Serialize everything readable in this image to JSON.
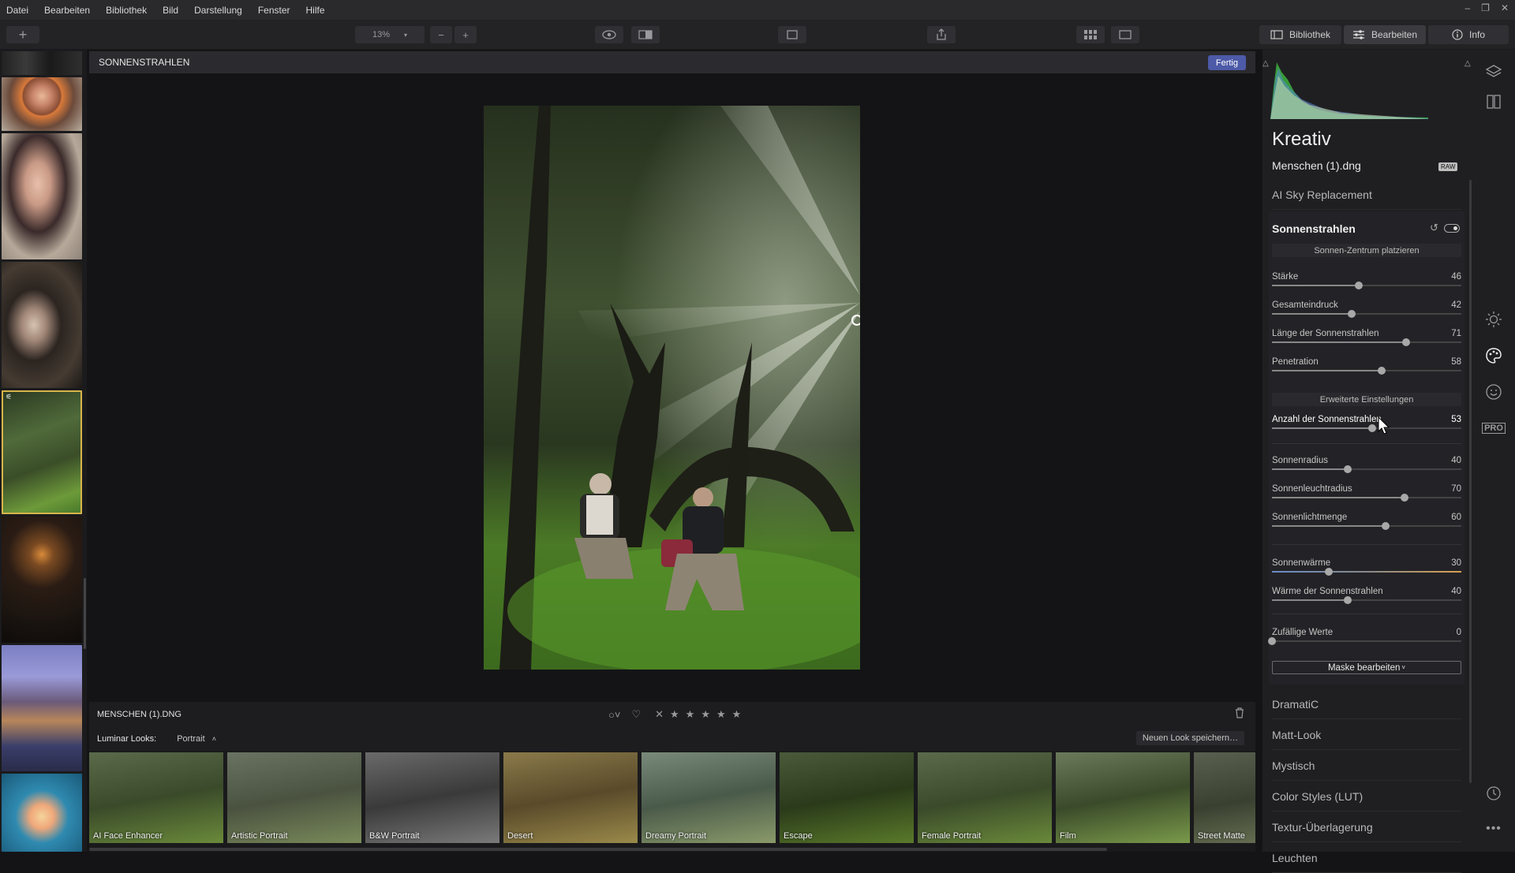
{
  "menu": [
    "Datei",
    "Bearbeiten",
    "Bibliothek",
    "Bild",
    "Darstellung",
    "Fenster",
    "Hilfe"
  ],
  "toolbar": {
    "zoom": "13%",
    "tabs": {
      "library": "Bibliothek",
      "edit": "Bearbeiten",
      "info": "Info"
    }
  },
  "document": {
    "title": "SONNENSTRAHLEN",
    "done_label": "Fertig"
  },
  "bottom": {
    "filename": "MENSCHEN (1).DNG",
    "looks_label": "Luminar Looks:",
    "looks_category": "Portrait",
    "save_look": "Neuen Look speichern…",
    "looks": [
      "AI Face Enhancer",
      "Artistic Portrait",
      "B&W Portrait",
      "Desert",
      "Dreamy Portrait",
      "Escape",
      "Female Portrait",
      "Film",
      "Street Matte"
    ]
  },
  "panel": {
    "section_title": "Kreativ",
    "filename": "Menschen (1).dng",
    "raw_badge": "RAW",
    "above_tool": "AI Sky Replacement",
    "tool_title": "Sonnenstrahlen",
    "place_center": "Sonnen-Zentrum platzieren",
    "advanced": "Erweiterte Einstellungen",
    "sliders_main": [
      {
        "name": "Stärke",
        "value": 46
      },
      {
        "name": "Gesamteindruck",
        "value": 42
      },
      {
        "name": "Länge der Sonnenstrahlen",
        "value": 71
      },
      {
        "name": "Penetration",
        "value": 58
      }
    ],
    "slider_rays": {
      "name": "Anzahl der Sonnenstrahlen",
      "value": 53
    },
    "sliders_sun": [
      {
        "name": "Sonnenradius",
        "value": 40
      },
      {
        "name": "Sonnenleuchtradius",
        "value": 70
      },
      {
        "name": "Sonnenlichtmenge",
        "value": 60
      }
    ],
    "sliders_warm": [
      {
        "name": "Sonnenwärme",
        "value": 30
      },
      {
        "name": "Wärme der Sonnenstrahlen",
        "value": 40
      }
    ],
    "slider_random": {
      "name": "Zufällige Werte",
      "value": 0
    },
    "mask_button": "Maske bearbeiten",
    "categories": [
      "DramatiC",
      "Matt-Look",
      "Mystisch",
      "Color Styles (LUT)",
      "Textur-Überlagerung",
      "Leuchten"
    ]
  },
  "rail": {
    "pro_label": "PRO"
  },
  "colors": {
    "accent": "#4d5aa8",
    "selected_border": "#d8b54a"
  }
}
